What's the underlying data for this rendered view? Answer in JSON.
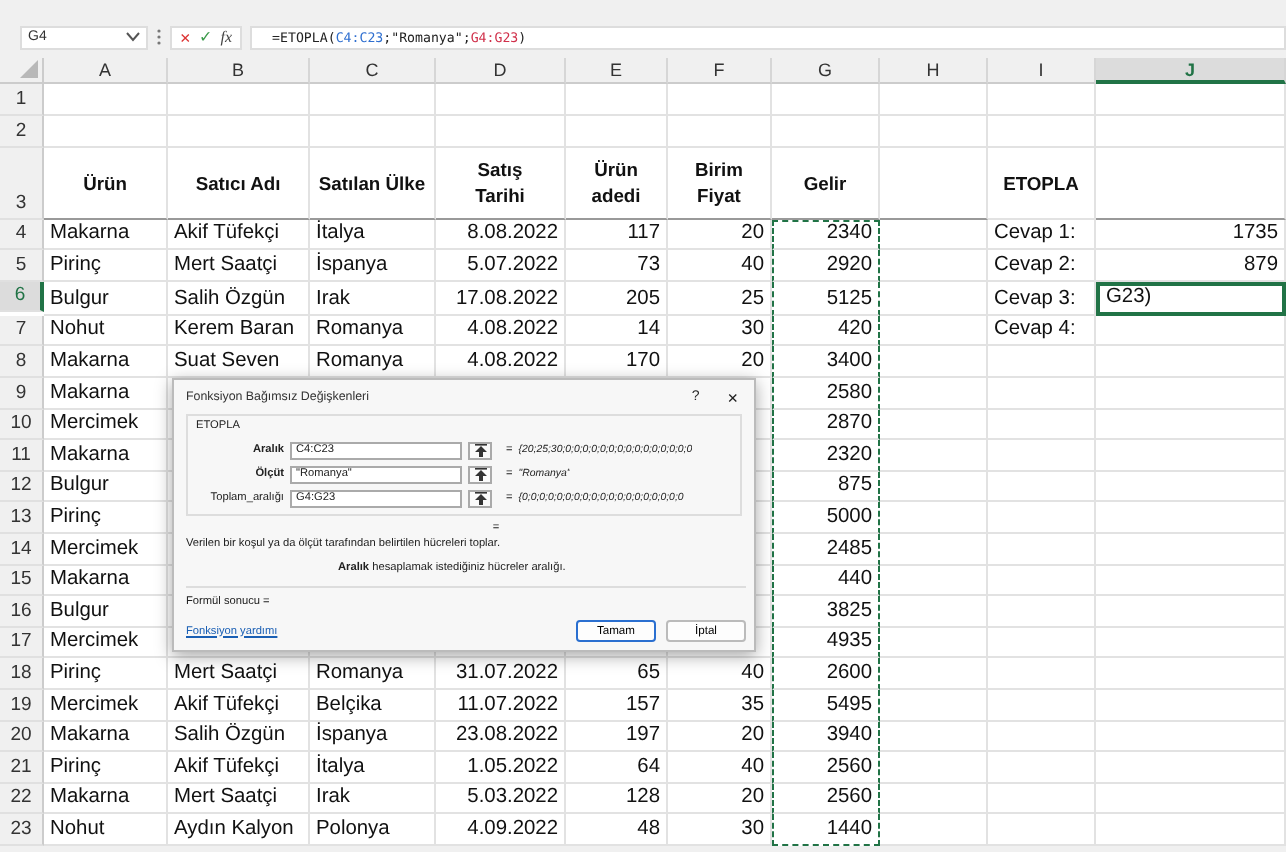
{
  "formula_bar": {
    "name_box": "G4",
    "function_label": "fx",
    "cancel": "×",
    "enter": "✓",
    "formula": [
      {
        "text": "=ETOPLA(",
        "color": "#222222"
      },
      {
        "text": "C4:C23",
        "color": "#2f6fd0"
      },
      {
        "text": ";\"Romanya\";",
        "color": "#222222"
      },
      {
        "text": "G4:G23",
        "color": "#d0304a"
      },
      {
        "text": ")",
        "color": "#222222"
      }
    ]
  },
  "columns": [
    {
      "label": "A",
      "selected": false,
      "marquee": false
    },
    {
      "label": "B",
      "selected": false,
      "marquee": false
    },
    {
      "label": "C",
      "selected": false,
      "marquee": false
    },
    {
      "label": "D",
      "selected": false,
      "marquee": false
    },
    {
      "label": "E",
      "selected": false,
      "marquee": false
    },
    {
      "label": "F",
      "selected": false,
      "marquee": false
    },
    {
      "label": "G",
      "selected": false,
      "marquee": true
    },
    {
      "label": "H",
      "selected": false,
      "marquee": false
    },
    {
      "label": "I",
      "selected": false,
      "marquee": false
    },
    {
      "label": "J",
      "selected": true,
      "marquee": false
    }
  ],
  "rows": [
    {
      "header": "1",
      "kind": "blank",
      "selected": false,
      "cells": {}
    },
    {
      "header": "2",
      "kind": "blank",
      "selected": false,
      "cells": {}
    },
    {
      "header": "3",
      "kind": "header",
      "selected": false,
      "cells": {
        "A": "Ürün",
        "B": "Satıcı Adı",
        "C": "Satılan Ülke",
        "D": "Satış\nTarihi",
        "E": "Ürün\nadedi",
        "F": "Birim\nFiyat",
        "G": "Gelir",
        "I": "ETOPLA"
      }
    },
    {
      "header": "4",
      "kind": "data",
      "selected": false,
      "cells": {
        "A": "Makarna",
        "B": "Akif Tüfekçi",
        "C": "İtalya",
        "D": "8.08.2022",
        "E": "117",
        "F": "20",
        "G": "2340",
        "I": "Cevap 1:",
        "J": "1735"
      }
    },
    {
      "header": "5",
      "kind": "data",
      "selected": false,
      "cells": {
        "A": "Pirinç",
        "B": "Mert Saatçi",
        "C": "İspanya",
        "D": "5.07.2022",
        "E": "73",
        "F": "40",
        "G": "2920",
        "I": "Cevap 2:",
        "J": "879"
      }
    },
    {
      "header": "6",
      "kind": "data",
      "selected": true,
      "cells": {
        "A": "Bulgur",
        "B": "Salih Özgün",
        "C": "Irak",
        "D": "17.08.2022",
        "E": "205",
        "F": "25",
        "G": "5125",
        "I": "Cevap 3:",
        "J": "G23)"
      }
    },
    {
      "header": "7",
      "kind": "data",
      "selected": false,
      "cells": {
        "A": "Nohut",
        "B": "Kerem Baran",
        "C": "Romanya",
        "D": "4.08.2022",
        "E": "14",
        "F": "30",
        "G": "420",
        "I": "Cevap 4:"
      }
    },
    {
      "header": "8",
      "kind": "data",
      "selected": false,
      "cells": {
        "A": "Makarna",
        "B": "Suat Seven",
        "C": "Romanya",
        "D": "4.08.2022",
        "E": "170",
        "F": "20",
        "G": "3400"
      }
    },
    {
      "header": "9",
      "kind": "data",
      "selected": false,
      "cells": {
        "A": "Makarna",
        "G": "2580"
      }
    },
    {
      "header": "10",
      "kind": "data",
      "selected": false,
      "cells": {
        "A": "Mercimek",
        "G": "2870"
      }
    },
    {
      "header": "11",
      "kind": "data",
      "selected": false,
      "cells": {
        "A": "Makarna",
        "G": "2320"
      }
    },
    {
      "header": "12",
      "kind": "data",
      "selected": false,
      "cells": {
        "A": "Bulgur",
        "G": "875"
      }
    },
    {
      "header": "13",
      "kind": "data",
      "selected": false,
      "cells": {
        "A": "Pirinç",
        "G": "5000"
      }
    },
    {
      "header": "14",
      "kind": "data",
      "selected": false,
      "cells": {
        "A": "Mercimek",
        "G": "2485"
      }
    },
    {
      "header": "15",
      "kind": "data",
      "selected": false,
      "cells": {
        "A": "Makarna",
        "G": "440"
      }
    },
    {
      "header": "16",
      "kind": "data",
      "selected": false,
      "cells": {
        "A": "Bulgur",
        "G": "3825"
      }
    },
    {
      "header": "17",
      "kind": "data",
      "selected": false,
      "cells": {
        "A": "Mercimek",
        "G": "4935"
      }
    },
    {
      "header": "18",
      "kind": "data",
      "selected": false,
      "cells": {
        "A": "Pirinç",
        "B": "Mert Saatçi",
        "C": "Romanya",
        "D": "31.07.2022",
        "E": "65",
        "F": "40",
        "G": "2600"
      }
    },
    {
      "header": "19",
      "kind": "data",
      "selected": false,
      "cells": {
        "A": "Mercimek",
        "B": "Akif Tüfekçi",
        "C": "Belçika",
        "D": "11.07.2022",
        "E": "157",
        "F": "35",
        "G": "5495"
      }
    },
    {
      "header": "20",
      "kind": "data",
      "selected": false,
      "cells": {
        "A": "Makarna",
        "B": "Salih Özgün",
        "C": "İspanya",
        "D": "23.08.2022",
        "E": "197",
        "F": "20",
        "G": "3940"
      }
    },
    {
      "header": "21",
      "kind": "data",
      "selected": false,
      "cells": {
        "A": "Pirinç",
        "B": "Akif Tüfekçi",
        "C": "İtalya",
        "D": "1.05.2022",
        "E": "64",
        "F": "40",
        "G": "2560"
      }
    },
    {
      "header": "22",
      "kind": "data",
      "selected": false,
      "cells": {
        "A": "Makarna",
        "B": "Mert Saatçi",
        "C": "Irak",
        "D": "5.03.2022",
        "E": "128",
        "F": "20",
        "G": "2560"
      }
    },
    {
      "header": "23",
      "kind": "data",
      "selected": false,
      "cells": {
        "A": "Nohut",
        "B": "Aydın Kalyon",
        "C": "Polonya",
        "D": "4.09.2022",
        "E": "48",
        "F": "30",
        "G": "1440"
      }
    }
  ],
  "dialog": {
    "title": "Fonksiyon Bağımsız Değişkenleri",
    "help": "?",
    "close": "×",
    "function_name": "ETOPLA",
    "arguments": [
      {
        "label": "Aralık",
        "bold": true,
        "value": "C4:C23",
        "sign": "=",
        "result": "{20;25;30;0;0;0;0;0;0;0;0;0;0;0;0;0;0;0"
      },
      {
        "label": "Ölçüt",
        "bold": true,
        "value": "\"Romanya\"",
        "sign": "=",
        "result": "\"Romanya\""
      },
      {
        "label": "Toplam_aralığı",
        "bold": false,
        "value": "G4:G23",
        "sign": "=",
        "result": "{0;0;0;0;0;0;0;0;0;0;0;0;0;0;0;0;0;0;0"
      }
    ],
    "total_sign": "=",
    "description": "Verilen bir koşul ya da ölçüt tarafından belirtilen hücreleri toplar.",
    "argument_help": "**Aralık**  hesaplamak istediğiniz hücreler aralığı.",
    "formula_result": "Formül sonucu =",
    "help_link": "Fonksiyon yardımı",
    "buttons": [
      {
        "label": "Tamam",
        "default": true
      },
      {
        "label": "İptal",
        "default": false
      }
    ]
  }
}
